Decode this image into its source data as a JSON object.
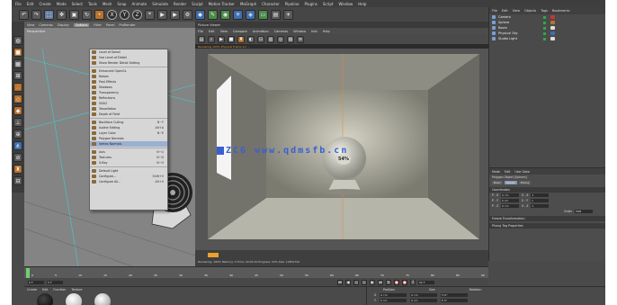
{
  "menubar": {
    "items": [
      "File",
      "Edit",
      "Create",
      "Mode",
      "Select",
      "Tools",
      "Mesh",
      "Snap",
      "Animate",
      "Simulate",
      "Render",
      "Sculpt",
      "Motion Tracker",
      "MoGraph",
      "Character",
      "Pipeline",
      "Plugins",
      "Script",
      "Window",
      "Help"
    ]
  },
  "viewport": {
    "tabs": [
      "View",
      "Cameras",
      "Display",
      "Options",
      "Filter",
      "Panel",
      "ProRender"
    ],
    "active_tab": "Options",
    "label": "Perspective",
    "options_menu": [
      {
        "label": "Level of Detail",
        "shortcut": ""
      },
      {
        "label": "Use Level of Detail",
        "shortcut": ""
      },
      {
        "label": "Show Render Detail Setting",
        "shortcut": ""
      },
      {
        "sep": true
      },
      {
        "label": "Enhanced OpenGL",
        "shortcut": ""
      },
      {
        "label": "Noises",
        "shortcut": ""
      },
      {
        "label": "Post Effects",
        "shortcut": ""
      },
      {
        "label": "Shadows",
        "shortcut": ""
      },
      {
        "label": "Transparency",
        "shortcut": ""
      },
      {
        "label": "Reflections",
        "shortcut": ""
      },
      {
        "label": "SSAO",
        "shortcut": ""
      },
      {
        "label": "Tessellation",
        "shortcut": ""
      },
      {
        "label": "Depth of Field",
        "shortcut": ""
      },
      {
        "sep": true
      },
      {
        "label": "Backface Culling",
        "shortcut": "N~F"
      },
      {
        "label": "Isoline Editing",
        "shortcut": "Alt+A"
      },
      {
        "label": "Layer Color",
        "shortcut": "N~E"
      },
      {
        "label": "Polygon Normals",
        "shortcut": ""
      },
      {
        "label": "Vertex Normals",
        "shortcut": "",
        "highlight": true
      },
      {
        "sep": true
      },
      {
        "label": "Axis",
        "shortcut": "N~G"
      },
      {
        "label": "Textures",
        "shortcut": "N~D"
      },
      {
        "label": "X-Ray",
        "shortcut": "N~H"
      },
      {
        "sep": true
      },
      {
        "label": "Default Light",
        "shortcut": ""
      },
      {
        "label": "Configure...",
        "shortcut": "Shift+V"
      },
      {
        "label": "Configure All...",
        "shortcut": "Alt+V"
      }
    ]
  },
  "render_view": {
    "title": "Picture Viewer",
    "menu": [
      "File",
      "Edit",
      "View",
      "Compare",
      "Animation",
      "Cameras",
      "Window",
      "Info",
      "Help"
    ],
    "status": "Rendering  100%  Physical  Frame 1/1 ...",
    "progress_pct": "54%",
    "info": "Rendering: 100%  Memory: 0  Time: 00:00:10  Progress: 54%  Size: 1280x720"
  },
  "watermark": "ZCG www.qdmsfb.cn",
  "object_manager": {
    "menu": [
      "File",
      "Edit",
      "View",
      "Objects",
      "Tags",
      "Bookmarks"
    ],
    "objects": [
      {
        "name": "Camera",
        "tag_color": "#cc3333"
      },
      {
        "name": "Sphere",
        "tag_color": "#b8722c"
      },
      {
        "name": "Room",
        "tag_color": "#dddddd"
      },
      {
        "name": "Physical Sky",
        "tag_color": "#3d6fb0"
      },
      {
        "name": "Studio Light",
        "tag_color": "#dddddd"
      }
    ]
  },
  "attributes": {
    "tabs": [
      "Mode",
      "Edit",
      "User Data"
    ],
    "title": "Polygon Object [Sphere]",
    "modes": [
      "Basic",
      "Coord.",
      "Phong"
    ],
    "selected_mode": "Coord.",
    "section": "Coordinates",
    "rows": [
      {
        "axis": "P . X",
        "value": "0 cm",
        "axis2": "S . X",
        "value2": "1"
      },
      {
        "axis": "P . Y",
        "value": "0 cm",
        "axis2": "S . Y",
        "value2": "1"
      },
      {
        "axis": "P . Z",
        "value": "0 cm",
        "axis2": "S . Z",
        "value2": "1"
      }
    ],
    "order_label": "Order",
    "order_value": "HPB",
    "freeze_label": "Freeze Transformation",
    "extra_label": "Phong Tag Properties"
  },
  "timeline": {
    "ticks": [
      "0",
      "5",
      "10",
      "15",
      "20",
      "25",
      "30",
      "35",
      "40",
      "45",
      "50",
      "55",
      "60",
      "65",
      "70",
      "75",
      "80",
      "85",
      "90"
    ],
    "start": "0 F",
    "end": "90 F"
  },
  "material_manager": {
    "menu": [
      "Create",
      "Edit",
      "Function",
      "Texture"
    ]
  },
  "coordinates": {
    "headers": [
      "Position",
      "Size",
      "Rotation"
    ],
    "rows": [
      {
        "axis": "X",
        "pos": "0 cm",
        "size": "0 cm",
        "rot": "H 0°"
      },
      {
        "axis": "Y",
        "pos": "0 cm",
        "size": "0 cm",
        "rot": "P 0°"
      }
    ]
  }
}
